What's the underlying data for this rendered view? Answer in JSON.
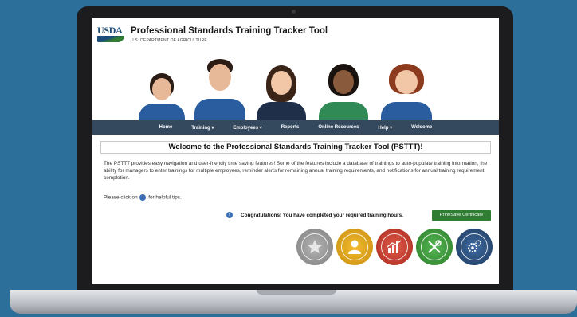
{
  "site": {
    "logo_text": "USDA",
    "title": "Professional Standards Training Tracker Tool",
    "subtitle": "U.S. DEPARTMENT OF AGRICULTURE"
  },
  "nav": {
    "items": [
      {
        "label": "Home"
      },
      {
        "label": "Training ▾"
      },
      {
        "label": "Employees ▾"
      },
      {
        "label": "Reports"
      },
      {
        "label": "Online Resources"
      },
      {
        "label": "Help ▾"
      },
      {
        "label": "Welcome"
      }
    ]
  },
  "main": {
    "welcome_heading": "Welcome to the Professional Standards Training Tracker Tool (PSTTT)!",
    "intro": "The PSTTT provides easy navigation and user-friendly time saving features! Some of the features include a database of trainings to auto-populate training information, the ability for managers to enter trainings for multiple employees, reminder alerts for remaining annual training requirements, and notifications for annual training requirement completion.",
    "tips_before": "Please click on",
    "tips_after": "for helpful tips.",
    "info_glyph": "i",
    "congrats": "Congratulations! You have completed your required training hours.",
    "certificate_button": "Print/Save Certificate"
  },
  "badges": [
    {
      "icon": "star-icon",
      "color": "#9a9a9a"
    },
    {
      "icon": "person-icon",
      "color": "#d8a21a"
    },
    {
      "icon": "chart-icon",
      "color": "#c0392b"
    },
    {
      "icon": "utensils-icon",
      "color": "#3e9b3c"
    },
    {
      "icon": "gears-icon",
      "color": "#2c4e78"
    }
  ],
  "colors": {
    "background": "#2d6f9b",
    "nav": "#34495e",
    "button": "#2e7d32"
  }
}
